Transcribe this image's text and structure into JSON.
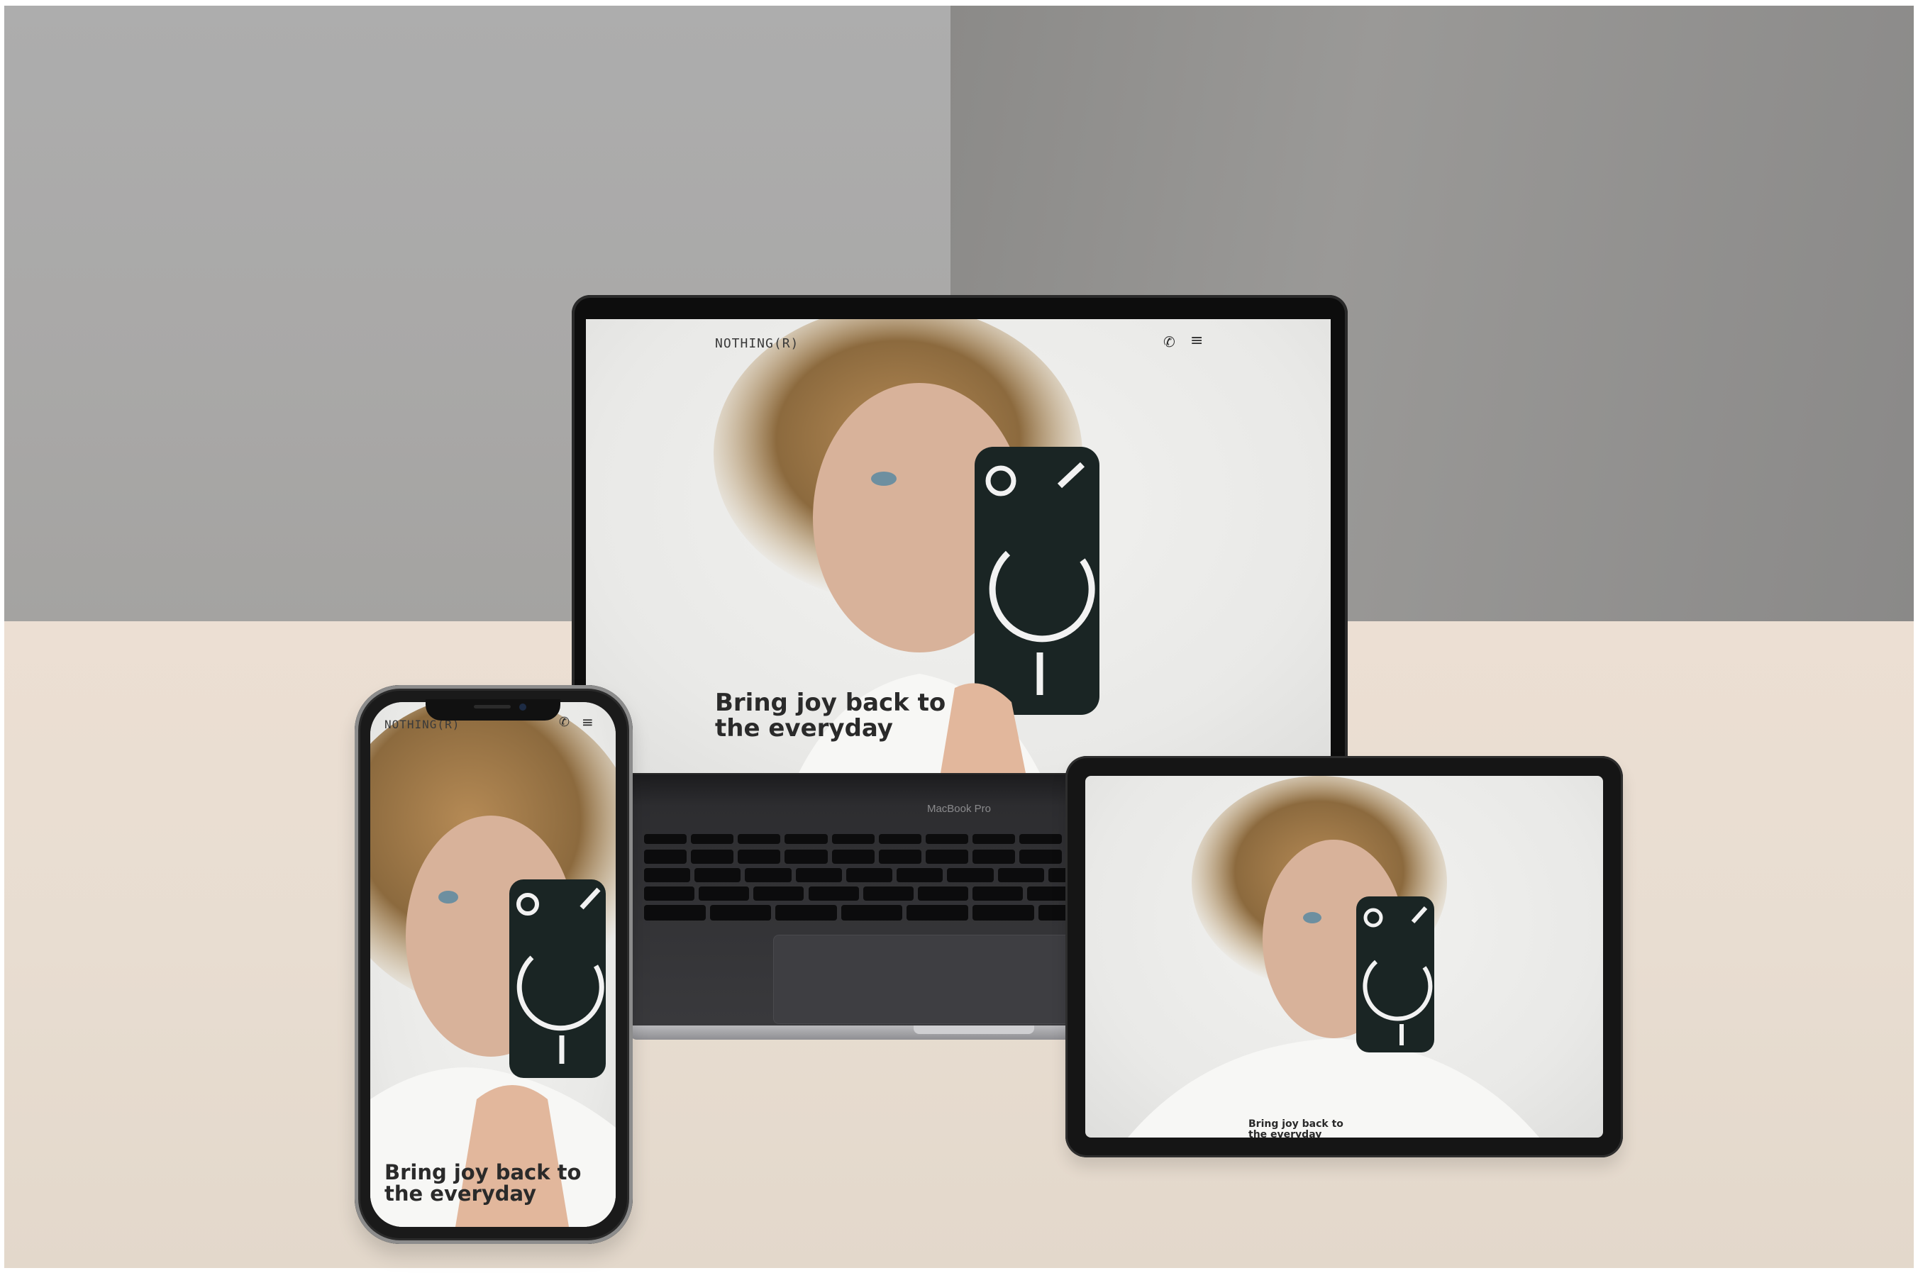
{
  "site": {
    "brand": "NOTHING(R)",
    "headline_line1": "Bring joy back to",
    "headline_line2": "the everyday",
    "phone_icon": "phone-icon",
    "menu_icon": "menu-icon"
  },
  "laptop": {
    "model_label": "MacBook Pro"
  },
  "colors": {
    "wall_left": "#adadad",
    "wall_right": "#8b8a88",
    "floor": "#e8ddd1",
    "device_frame": "#151515",
    "headline": "#2a2a2a",
    "glyph_glow": "#f2f2f2"
  }
}
